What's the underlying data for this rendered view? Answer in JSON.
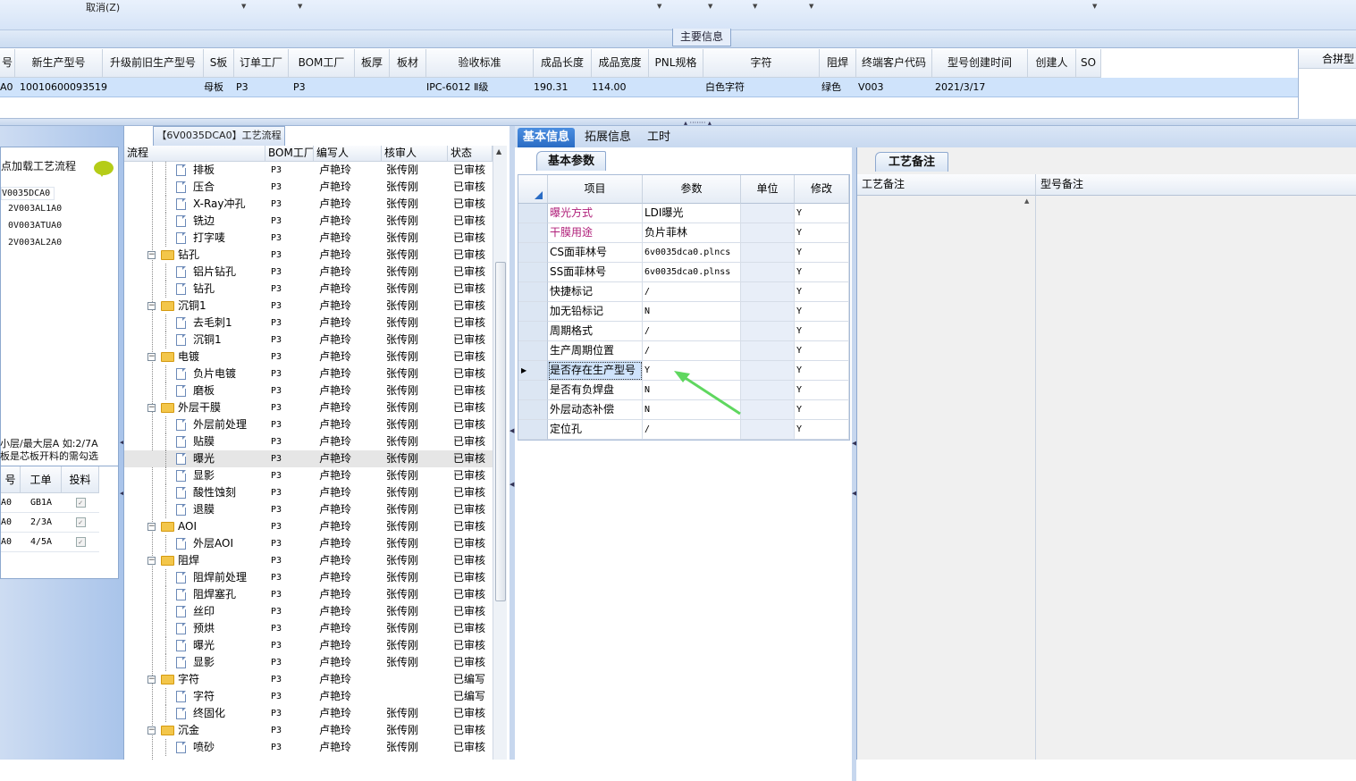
{
  "toolbar": {
    "cancel_label": "取消(Z)"
  },
  "main_section": {
    "title": "主要信息"
  },
  "main_grid": {
    "headers": [
      "号",
      "新生产型号",
      "升级前旧生产型号",
      "S板",
      "订单工厂",
      "BOM工厂",
      "板厚",
      "板材",
      "验收标准",
      "成品长度",
      "成品宽度",
      "PNL规格",
      "字符",
      "阻焊",
      "终端客户代码",
      "型号创建时间",
      "创建人",
      "SO"
    ],
    "row": [
      "A0",
      "10010600093519",
      "",
      "母板",
      "P3",
      "P3",
      "",
      "",
      "IPC-6012 Ⅱ级",
      "190.31",
      "114.00",
      "",
      "白色字符",
      "绿色",
      "V003",
      "2021/3/17",
      "",
      ""
    ],
    "right_header": "合拼型"
  },
  "left_panel": {
    "title": "点加载工艺流程",
    "items": [
      "V0035DCA0",
      "2V003AL1A0",
      "0V003ATUA0",
      "2V003AL2A0"
    ],
    "note_line1": "小层/最大层A 如:2/7A",
    "note_line2": "板是芯板开料的需勾选",
    "grid_headers": [
      "号",
      "工单",
      "投料"
    ],
    "grid_rows": [
      [
        "A0",
        "GB1A"
      ],
      [
        "A0",
        "2/3A"
      ],
      [
        "A0",
        "4/5A"
      ]
    ],
    "checkmark": "✓"
  },
  "process_panel": {
    "tab_title": "【6V0035DCA0】工艺流程",
    "headers": [
      "流程",
      "BOM工厂",
      "编写人",
      "核审人",
      "状态"
    ],
    "rows": [
      {
        "name": "排板",
        "type": "leaf",
        "factory": "P3",
        "writer": "卢艳玲",
        "reviewer": "张传刚",
        "status": "已审核"
      },
      {
        "name": "压合",
        "type": "leaf",
        "factory": "P3",
        "writer": "卢艳玲",
        "reviewer": "张传刚",
        "status": "已审核"
      },
      {
        "name": "X-Ray冲孔",
        "type": "leaf",
        "factory": "P3",
        "writer": "卢艳玲",
        "reviewer": "张传刚",
        "status": "已审核"
      },
      {
        "name": "铣边",
        "type": "leaf",
        "factory": "P3",
        "writer": "卢艳玲",
        "reviewer": "张传刚",
        "status": "已审核"
      },
      {
        "name": "打字唛",
        "type": "leaf",
        "factory": "P3",
        "writer": "卢艳玲",
        "reviewer": "张传刚",
        "status": "已审核"
      },
      {
        "name": "钻孔",
        "type": "folder",
        "factory": "P3",
        "writer": "卢艳玲",
        "reviewer": "张传刚",
        "status": "已审核"
      },
      {
        "name": "铝片钻孔",
        "type": "leaf",
        "factory": "P3",
        "writer": "卢艳玲",
        "reviewer": "张传刚",
        "status": "已审核"
      },
      {
        "name": "钻孔",
        "type": "leaf",
        "factory": "P3",
        "writer": "卢艳玲",
        "reviewer": "张传刚",
        "status": "已审核"
      },
      {
        "name": "沉铜1",
        "type": "folder",
        "factory": "P3",
        "writer": "卢艳玲",
        "reviewer": "张传刚",
        "status": "已审核"
      },
      {
        "name": "去毛刺1",
        "type": "leaf",
        "factory": "P3",
        "writer": "卢艳玲",
        "reviewer": "张传刚",
        "status": "已审核"
      },
      {
        "name": "沉铜1",
        "type": "leaf",
        "factory": "P3",
        "writer": "卢艳玲",
        "reviewer": "张传刚",
        "status": "已审核"
      },
      {
        "name": "电镀",
        "type": "folder",
        "factory": "P3",
        "writer": "卢艳玲",
        "reviewer": "张传刚",
        "status": "已审核"
      },
      {
        "name": "负片电镀",
        "type": "leaf",
        "factory": "P3",
        "writer": "卢艳玲",
        "reviewer": "张传刚",
        "status": "已审核"
      },
      {
        "name": "磨板",
        "type": "leaf",
        "factory": "P3",
        "writer": "卢艳玲",
        "reviewer": "张传刚",
        "status": "已审核"
      },
      {
        "name": "外层干膜",
        "type": "folder",
        "factory": "P3",
        "writer": "卢艳玲",
        "reviewer": "张传刚",
        "status": "已审核"
      },
      {
        "name": "外层前处理",
        "type": "leaf",
        "factory": "P3",
        "writer": "卢艳玲",
        "reviewer": "张传刚",
        "status": "已审核"
      },
      {
        "name": "贴膜",
        "type": "leaf",
        "factory": "P3",
        "writer": "卢艳玲",
        "reviewer": "张传刚",
        "status": "已审核"
      },
      {
        "name": "曝光",
        "type": "leaf",
        "factory": "P3",
        "writer": "卢艳玲",
        "reviewer": "张传刚",
        "status": "已审核",
        "selected": true
      },
      {
        "name": "显影",
        "type": "leaf",
        "factory": "P3",
        "writer": "卢艳玲",
        "reviewer": "张传刚",
        "status": "已审核"
      },
      {
        "name": "酸性蚀刻",
        "type": "leaf",
        "factory": "P3",
        "writer": "卢艳玲",
        "reviewer": "张传刚",
        "status": "已审核"
      },
      {
        "name": "退膜",
        "type": "leaf",
        "factory": "P3",
        "writer": "卢艳玲",
        "reviewer": "张传刚",
        "status": "已审核"
      },
      {
        "name": "AOI",
        "type": "folder",
        "factory": "P3",
        "writer": "卢艳玲",
        "reviewer": "张传刚",
        "status": "已审核"
      },
      {
        "name": "外层AOI",
        "type": "leaf",
        "factory": "P3",
        "writer": "卢艳玲",
        "reviewer": "张传刚",
        "status": "已审核"
      },
      {
        "name": "阻焊",
        "type": "folder",
        "factory": "P3",
        "writer": "卢艳玲",
        "reviewer": "张传刚",
        "status": "已审核"
      },
      {
        "name": "阻焊前处理",
        "type": "leaf",
        "factory": "P3",
        "writer": "卢艳玲",
        "reviewer": "张传刚",
        "status": "已审核"
      },
      {
        "name": "阻焊塞孔",
        "type": "leaf",
        "factory": "P3",
        "writer": "卢艳玲",
        "reviewer": "张传刚",
        "status": "已审核"
      },
      {
        "name": "丝印",
        "type": "leaf",
        "factory": "P3",
        "writer": "卢艳玲",
        "reviewer": "张传刚",
        "status": "已审核"
      },
      {
        "name": "预烘",
        "type": "leaf",
        "factory": "P3",
        "writer": "卢艳玲",
        "reviewer": "张传刚",
        "status": "已审核"
      },
      {
        "name": "曝光",
        "type": "leaf",
        "factory": "P3",
        "writer": "卢艳玲",
        "reviewer": "张传刚",
        "status": "已审核"
      },
      {
        "name": "显影",
        "type": "leaf",
        "factory": "P3",
        "writer": "卢艳玲",
        "reviewer": "张传刚",
        "status": "已审核"
      },
      {
        "name": "字符",
        "type": "folder",
        "factory": "P3",
        "writer": "卢艳玲",
        "reviewer": "",
        "status": "已编写"
      },
      {
        "name": "字符",
        "type": "leaf",
        "factory": "P3",
        "writer": "卢艳玲",
        "reviewer": "",
        "status": "已编写"
      },
      {
        "name": "终固化",
        "type": "leaf",
        "factory": "P3",
        "writer": "卢艳玲",
        "reviewer": "张传刚",
        "status": "已审核"
      },
      {
        "name": "沉金",
        "type": "folder",
        "factory": "P3",
        "writer": "卢艳玲",
        "reviewer": "张传刚",
        "status": "已审核"
      },
      {
        "name": "喷砂",
        "type": "leaf",
        "factory": "P3",
        "writer": "卢艳玲",
        "reviewer": "张传刚",
        "status": "已审核"
      }
    ]
  },
  "info_panel": {
    "tabs": [
      "基本信息",
      "拓展信息",
      "工时"
    ],
    "subtab": "基本参数",
    "headers": [
      "项目",
      "参数",
      "单位",
      "修改"
    ],
    "rows": [
      {
        "item": "曝光方式",
        "param": "LDI曝光",
        "unit": "",
        "modify": "Y",
        "highlight": true
      },
      {
        "item": "干膜用途",
        "param": "负片菲林",
        "unit": "",
        "modify": "Y",
        "highlight": true
      },
      {
        "item": "CS面菲林号",
        "param": "6v0035dca0.plncs",
        "unit": "",
        "modify": "Y",
        "mono": true
      },
      {
        "item": "SS面菲林号",
        "param": "6v0035dca0.plnss",
        "unit": "",
        "modify": "Y",
        "mono": true
      },
      {
        "item": "快捷标记",
        "param": "/",
        "unit": "",
        "modify": "Y",
        "mono": true
      },
      {
        "item": "加无铅标记",
        "param": "N",
        "unit": "",
        "modify": "Y",
        "mono": true
      },
      {
        "item": "周期格式",
        "param": "/",
        "unit": "",
        "modify": "Y",
        "mono": true
      },
      {
        "item": "生产周期位置",
        "param": "/",
        "unit": "",
        "modify": "Y",
        "mono": true
      },
      {
        "item": "是否存在生产型号",
        "param": "Y",
        "unit": "",
        "modify": "Y",
        "mono": true,
        "current": true
      },
      {
        "item": "是否有负焊盘",
        "param": "N",
        "unit": "",
        "modify": "Y",
        "mono": true
      },
      {
        "item": "外层动态补偿",
        "param": "N",
        "unit": "",
        "modify": "Y",
        "mono": true
      },
      {
        "item": "定位孔",
        "param": "/",
        "unit": "",
        "modify": "Y",
        "mono": true
      }
    ],
    "highlight_color": "#b0207a"
  },
  "notes_panel": {
    "tab": "工艺备注",
    "headers": [
      "工艺备注",
      "型号备注"
    ]
  }
}
